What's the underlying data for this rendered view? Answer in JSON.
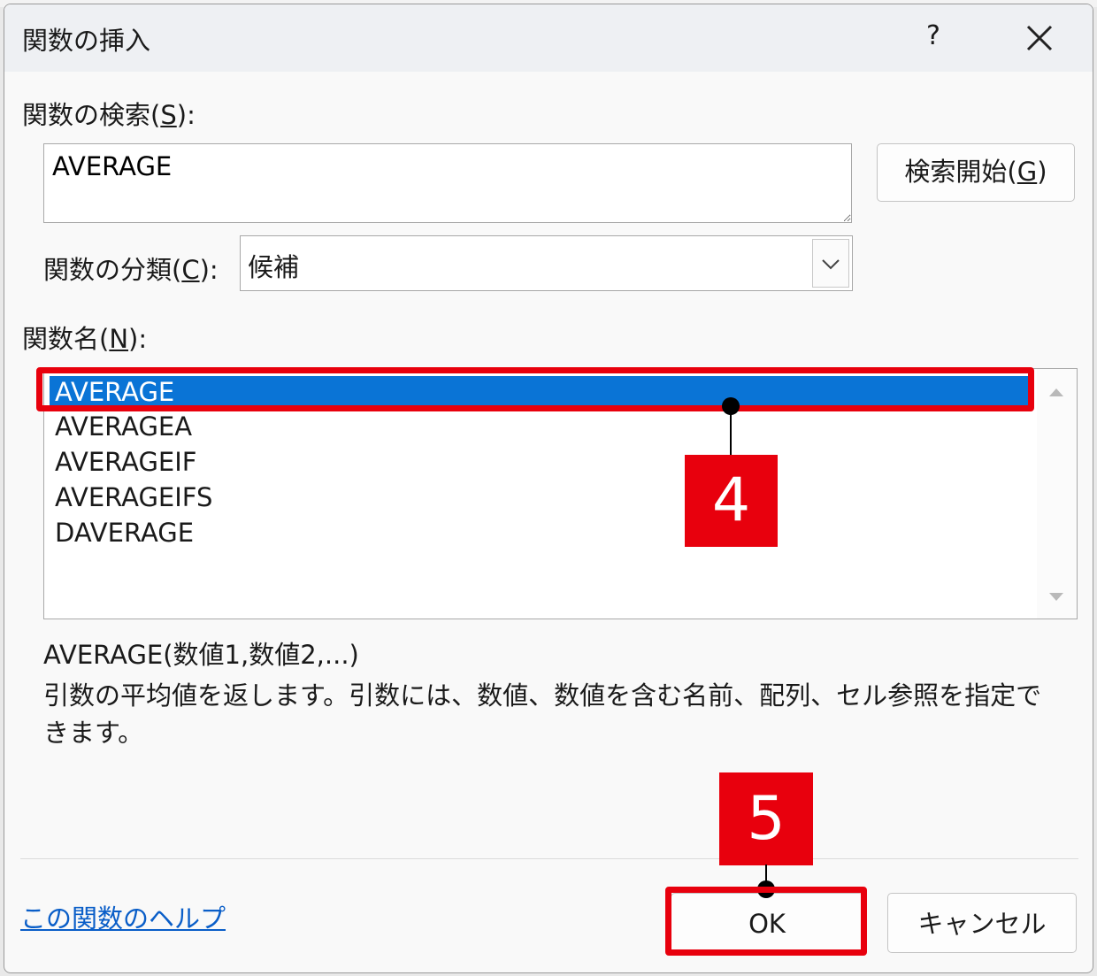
{
  "dialog": {
    "title": "関数の挿入",
    "help_glyph": "?",
    "close_icon": "close-icon"
  },
  "search": {
    "label_prefix": "関数の検索(",
    "label_mnemonic": "S",
    "label_suffix": "):",
    "value": "AVERAGE",
    "button_prefix": "検索開始(",
    "button_mnemonic": "G",
    "button_suffix": ")"
  },
  "category": {
    "label_prefix": "関数の分類(",
    "label_mnemonic": "C",
    "label_suffix": "):",
    "selected": "候補"
  },
  "function_list": {
    "label_prefix": "関数名(",
    "label_mnemonic": "N",
    "label_suffix": "):",
    "items": [
      "AVERAGE",
      "AVERAGEA",
      "AVERAGEIF",
      "AVERAGEIFS",
      "DAVERAGE"
    ],
    "selected_index": 0
  },
  "description": {
    "signature": "AVERAGE(数値1,数値2,...)",
    "text": "引数の平均値を返します。引数には、数値、数値を含む名前、配列、セル参照を指定できます。"
  },
  "footer": {
    "help_link": "この関数のヘルプ",
    "ok_label": "OK",
    "cancel_label": "キャンセル"
  },
  "annotations": {
    "step4": "4",
    "step5": "5",
    "color": "#e8000d"
  },
  "colors": {
    "selection": "#0a74d6",
    "link": "#0a5ec8"
  }
}
